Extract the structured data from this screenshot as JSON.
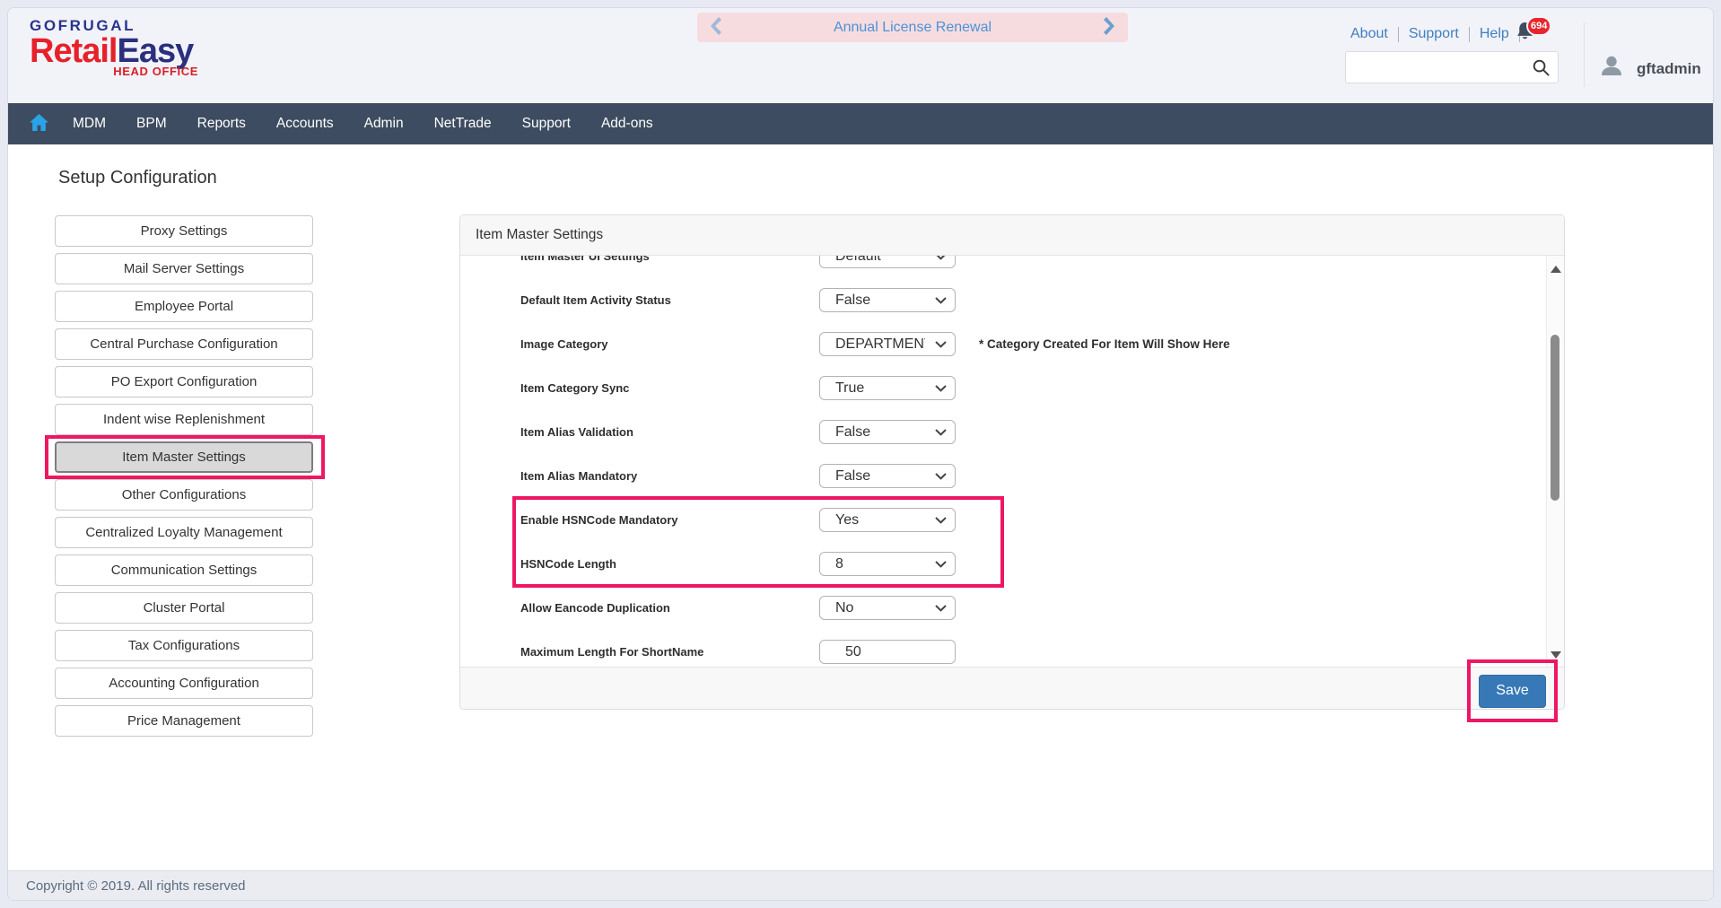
{
  "header": {
    "logo": {
      "brand": "GOFRUGAL",
      "product_part1": "Retail",
      "product_part2": "Easy",
      "subtitle": "HEAD OFFICE"
    },
    "banner": {
      "label": "Annual License Renewal"
    },
    "links": [
      "About",
      "Support",
      "Help"
    ],
    "notification_count": "694",
    "search": {
      "value": "",
      "placeholder": ""
    },
    "user_name": "gftadmin"
  },
  "nav": {
    "items": [
      "MDM",
      "BPM",
      "Reports",
      "Accounts",
      "Admin",
      "NetTrade",
      "Support",
      "Add-ons"
    ]
  },
  "sidebar": {
    "title": "Setup Configuration",
    "items": [
      {
        "label": "Proxy Settings"
      },
      {
        "label": "Mail Server Settings"
      },
      {
        "label": "Employee Portal"
      },
      {
        "label": "Central Purchase Configuration"
      },
      {
        "label": "PO Export Configuration"
      },
      {
        "label": "Indent wise Replenishment"
      },
      {
        "label": "Item Master Settings",
        "selected": true
      },
      {
        "label": "Other Configurations"
      },
      {
        "label": "Centralized Loyalty Management"
      },
      {
        "label": "Communication Settings"
      },
      {
        "label": "Cluster Portal"
      },
      {
        "label": "Tax Configurations"
      },
      {
        "label": "Accounting Configuration"
      },
      {
        "label": "Price Management"
      }
    ]
  },
  "panel": {
    "title": "Item Master Settings",
    "rows": [
      {
        "label": "Item Master UI Settings",
        "value": "Default",
        "clipped": true
      },
      {
        "label": "Default Item Activity Status",
        "value": "False"
      },
      {
        "label": "Image Category",
        "value": "DEPARTMENT",
        "note": "* Category Created For Item Will Show Here"
      },
      {
        "label": "Item Category Sync",
        "value": "True"
      },
      {
        "label": "Item Alias Validation",
        "value": "False"
      },
      {
        "label": "Item Alias Mandatory",
        "value": "False"
      },
      {
        "label": "Enable HSNCode Mandatory",
        "value": "Yes",
        "highlighted": true
      },
      {
        "label": "HSNCode Length",
        "value": "8",
        "highlighted": true
      },
      {
        "label": "Allow Eancode Duplication",
        "value": "No"
      },
      {
        "label": "Maximum Length For ShortName",
        "value": "50",
        "is_input": true
      }
    ],
    "save_label": "Save"
  },
  "footer": {
    "copyright": "Copyright © 2019. All rights reserved"
  },
  "colors": {
    "accent_pink": "#ee1763",
    "nav_bg": "#3d4c60",
    "save_blue": "#3779b7",
    "badge_red": "#e8252c",
    "link_blue": "#4080bf",
    "banner_bg": "#f7dcdf",
    "banner_text_blue": "#4a93d8",
    "header_bg": "#f2f2f9"
  }
}
